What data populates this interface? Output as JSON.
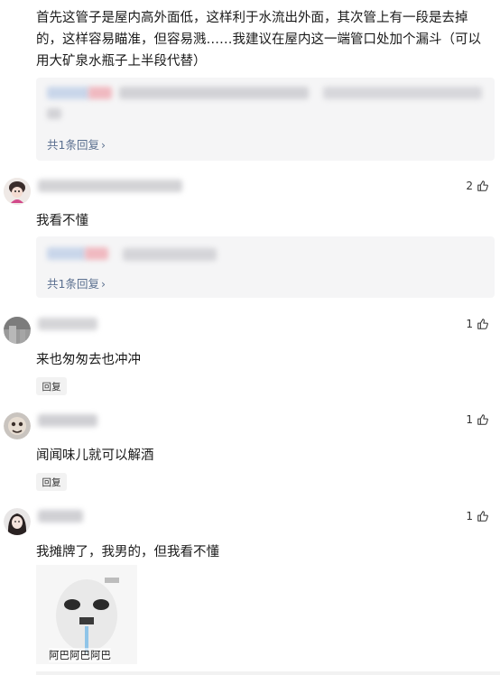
{
  "comments": [
    {
      "text": "首先这管子是屋内高外面低，这样利于水流出外面，其次管上有一段是去掉的，这样容易瞄准，但容易溅……我建议在屋内这一端管口处加个漏斗（可以用大矿泉水瓶子上半段代替）",
      "reply_count": "共1条回复",
      "chevron": "›"
    },
    {
      "likes": "2",
      "text": "我看不懂",
      "reply_count": "共1条回复",
      "chevron": "›"
    },
    {
      "likes": "1",
      "text": "来也匆匆去也冲冲",
      "reply_label": "回复"
    },
    {
      "likes": "1",
      "text": "闻闻味儿就可以解酒",
      "reply_label": "回复"
    },
    {
      "likes": "1",
      "text": "我摊牌了，我男的，但我看不懂",
      "meme_caption": "阿巴阿巴阿巴"
    }
  ],
  "icons": {
    "like": "thumbs-up-icon",
    "chevron": "chevron-right-icon"
  },
  "colors": {
    "reply_link": "#5a6f8f",
    "reply_box_bg": "#f5f5f6"
  }
}
